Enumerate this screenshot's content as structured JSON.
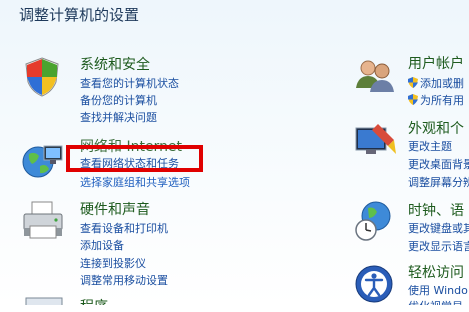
{
  "header": {
    "title": "调整计算机的设置"
  },
  "left": [
    {
      "title": "系统和安全",
      "icon": "shield-flag-icon",
      "links": [
        "查看您的计算机状态",
        "备份您的计算机",
        "查找并解决问题"
      ]
    },
    {
      "title": "网络和 Internet",
      "icon": "network-globe-icon",
      "links": [
        "查看网络状态和任务",
        "选择家庭组和共享选项"
      ]
    },
    {
      "title": "硬件和声音",
      "icon": "printer-icon",
      "links": [
        "查看设备和打印机",
        "添加设备",
        "连接到投影仪",
        "调整常用移动设置"
      ]
    },
    {
      "title": "程序",
      "icon": "programs-icon",
      "links": []
    }
  ],
  "right": [
    {
      "title": "用户帐户",
      "icon": "users-icon",
      "links": [
        "添加或删",
        "为所有用"
      ]
    },
    {
      "title": "外观和个",
      "icon": "appearance-icon",
      "links": [
        "更改主题",
        "更改桌面背景",
        "调整屏幕分辨"
      ]
    },
    {
      "title": "时钟、语",
      "icon": "clock-globe-icon",
      "links": [
        "更改键盘或其",
        "更改显示语言"
      ]
    },
    {
      "title": "轻松访问",
      "icon": "ease-of-access-icon",
      "links": [
        "使用 Windo",
        "优化视觉显"
      ]
    }
  ]
}
